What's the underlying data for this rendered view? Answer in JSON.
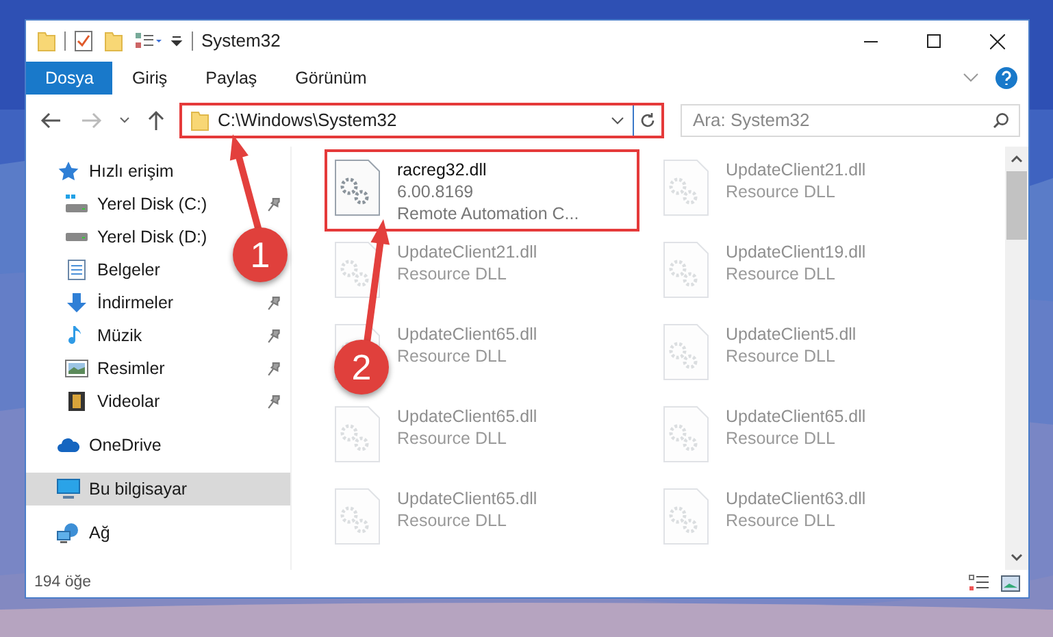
{
  "window": {
    "title": "System32"
  },
  "ribbon_tabs": [
    {
      "label": "Dosya",
      "selected": true
    },
    {
      "label": "Giriş",
      "selected": false
    },
    {
      "label": "Paylaş",
      "selected": false
    },
    {
      "label": "Görünüm",
      "selected": false
    }
  ],
  "address": {
    "path": "C:\\Windows\\System32",
    "highlighted": true
  },
  "search": {
    "placeholder": "Ara: System32"
  },
  "sidebar": {
    "items": [
      {
        "label": "Hızlı erişim",
        "kind": "star",
        "selected": false,
        "children": [
          {
            "label": "Yerel Disk (C:)",
            "kind": "drive-c",
            "pinned": true,
            "selected": false
          },
          {
            "label": "Yerel Disk (D:)",
            "kind": "drive",
            "pinned": false,
            "selected": false
          },
          {
            "label": "Belgeler",
            "kind": "document",
            "pinned": false,
            "selected": false
          },
          {
            "label": "İndirmeler",
            "kind": "download",
            "pinned": true,
            "selected": false
          },
          {
            "label": "Müzik",
            "kind": "music",
            "pinned": true,
            "selected": false
          },
          {
            "label": "Resimler",
            "kind": "pictures",
            "pinned": true,
            "selected": false
          },
          {
            "label": "Videolar",
            "kind": "video",
            "pinned": true,
            "selected": false
          }
        ]
      },
      {
        "label": "OneDrive",
        "kind": "cloud",
        "selected": false
      },
      {
        "label": "Bu bilgisayar",
        "kind": "computer",
        "selected": true
      },
      {
        "label": "Ağ",
        "kind": "network",
        "selected": false
      }
    ]
  },
  "files": [
    {
      "name": "racreg32.dll",
      "details": [
        "6.00.8169",
        "Remote Automation C..."
      ],
      "highlighted": true,
      "blurred": false
    },
    {
      "name": "UpdateClient21.dll",
      "details": [
        "Resource DLL"
      ],
      "highlighted": false,
      "blurred": true
    },
    {
      "name": "UpdateClient21.dll",
      "details": [
        "Resource DLL"
      ],
      "highlighted": false,
      "blurred": true
    },
    {
      "name": "UpdateClient19.dll",
      "details": [
        "Resource DLL"
      ],
      "highlighted": false,
      "blurred": true
    },
    {
      "name": "UpdateClient65.dll",
      "details": [
        "Resource DLL"
      ],
      "highlighted": false,
      "blurred": true
    },
    {
      "name": "UpdateClient5.dll",
      "details": [
        "Resource DLL"
      ],
      "highlighted": false,
      "blurred": true
    },
    {
      "name": "UpdateClient65.dll",
      "details": [
        "Resource DLL"
      ],
      "highlighted": false,
      "blurred": true
    },
    {
      "name": "UpdateClient65.dll",
      "details": [
        "Resource DLL"
      ],
      "highlighted": false,
      "blurred": true
    },
    {
      "name": "UpdateClient65.dll",
      "details": [
        "Resource DLL"
      ],
      "highlighted": false,
      "blurred": true
    },
    {
      "name": "UpdateClient63.dll",
      "details": [
        "Resource DLL"
      ],
      "highlighted": false,
      "blurred": true
    }
  ],
  "status_bar": {
    "item_count": "194 öğe"
  },
  "annotations": [
    {
      "label": "1"
    },
    {
      "label": "2"
    }
  ]
}
